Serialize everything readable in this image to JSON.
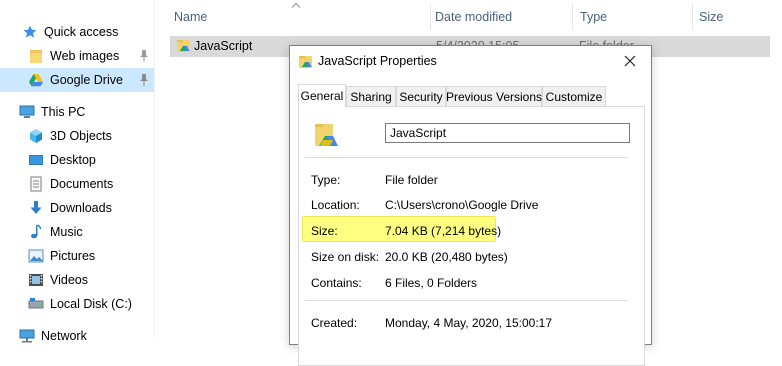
{
  "nav": {
    "items": [
      {
        "label": "Quick access",
        "icon": "star-icon"
      },
      {
        "label": "Web images",
        "icon": "folder-icon",
        "pinned": true
      },
      {
        "label": "Google Drive",
        "icon": "google-drive-icon",
        "pinned": true,
        "selected": true
      },
      {
        "label": "This PC",
        "icon": "computer-icon"
      },
      {
        "label": "3D Objects",
        "icon": "cube-icon"
      },
      {
        "label": "Desktop",
        "icon": "desktop-icon"
      },
      {
        "label": "Documents",
        "icon": "document-icon"
      },
      {
        "label": "Downloads",
        "icon": "download-icon"
      },
      {
        "label": "Music",
        "icon": "music-icon"
      },
      {
        "label": "Pictures",
        "icon": "picture-icon"
      },
      {
        "label": "Videos",
        "icon": "video-icon"
      },
      {
        "label": "Local Disk (C:)",
        "icon": "disk-icon"
      },
      {
        "label": "Network",
        "icon": "network-icon"
      }
    ]
  },
  "list": {
    "columns": [
      "Name",
      "Date modified",
      "Type",
      "Size"
    ],
    "rows": [
      {
        "name": "JavaScript",
        "date": "5/4/2020 15:05",
        "type": "File folder"
      }
    ]
  },
  "dialog": {
    "title": "JavaScript Properties",
    "tabs": [
      "General",
      "Sharing",
      "Security",
      "Previous Versions",
      "Customize"
    ],
    "active_tab": "General",
    "name_value": "JavaScript",
    "props": {
      "type_label": "Type:",
      "type_value": "File folder",
      "location_label": "Location:",
      "location_value": "C:\\Users\\crono\\Google Drive",
      "size_label": "Size:",
      "size_value": "7.04 KB (7,214 bytes)",
      "size_on_disk_label": "Size on disk:",
      "size_on_disk_value": "20.0 KB (20,480 bytes)",
      "contains_label": "Contains:",
      "contains_value": "6 Files, 0 Folders",
      "created_label": "Created:",
      "created_value": "Monday, 4 May, 2020, 15:00:17"
    }
  },
  "colors": {
    "selection": "#cce8ff",
    "highlight": "#ffff80",
    "header_text": "#4c607a"
  }
}
